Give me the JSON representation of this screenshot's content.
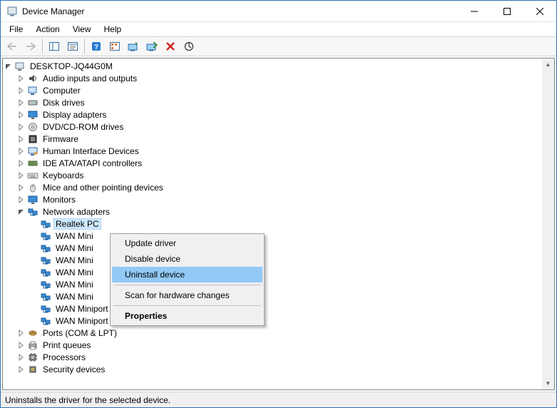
{
  "window": {
    "title": "Device Manager"
  },
  "menubar": {
    "file": "File",
    "action": "Action",
    "view": "View",
    "help": "Help"
  },
  "tree": {
    "root": "DESKTOP-JQ44G0M",
    "categories": [
      {
        "label": "Audio inputs and outputs",
        "icon": "audio"
      },
      {
        "label": "Computer",
        "icon": "computer"
      },
      {
        "label": "Disk drives",
        "icon": "disk"
      },
      {
        "label": "Display adapters",
        "icon": "display"
      },
      {
        "label": "DVD/CD-ROM drives",
        "icon": "dvd"
      },
      {
        "label": "Firmware",
        "icon": "firmware"
      },
      {
        "label": "Human Interface Devices",
        "icon": "hid"
      },
      {
        "label": "IDE ATA/ATAPI controllers",
        "icon": "ide"
      },
      {
        "label": "Keyboards",
        "icon": "keyboard"
      },
      {
        "label": "Mice and other pointing devices",
        "icon": "mouse"
      },
      {
        "label": "Monitors",
        "icon": "monitor"
      },
      {
        "label": "Network adapters",
        "icon": "net",
        "expanded": true
      },
      {
        "label": "Ports (COM & LPT)",
        "icon": "port"
      },
      {
        "label": "Print queues",
        "icon": "print"
      },
      {
        "label": "Processors",
        "icon": "cpu"
      },
      {
        "label": "Security devices",
        "icon": "security"
      }
    ],
    "network_children": [
      "Realtek PC",
      "WAN Mini",
      "WAN Mini",
      "WAN Mini",
      "WAN Mini",
      "WAN Mini",
      "WAN Mini",
      "WAN Miniport (PPTP)",
      "WAN Miniport (SSTP)"
    ]
  },
  "context_menu": {
    "update": "Update driver",
    "disable": "Disable device",
    "uninstall": "Uninstall device",
    "scan": "Scan for hardware changes",
    "properties": "Properties"
  },
  "statusbar": {
    "text": "Uninstalls the driver for the selected device."
  }
}
